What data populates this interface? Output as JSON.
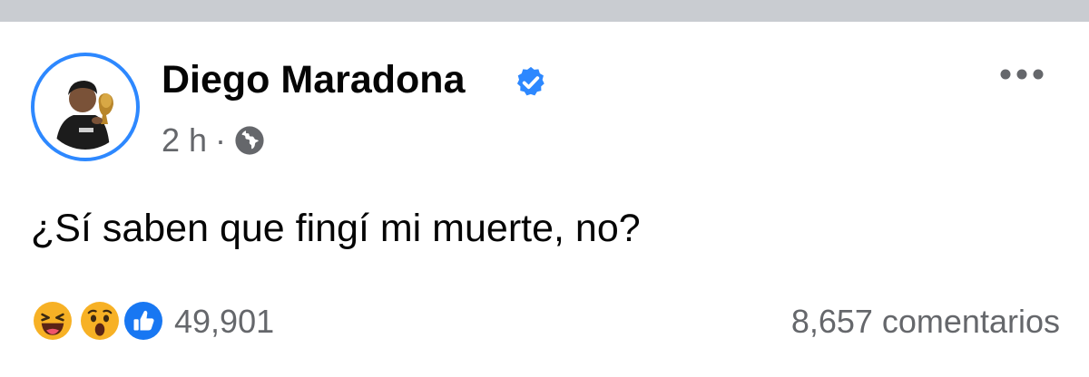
{
  "post": {
    "author": "Diego Maradona",
    "time": "2 h",
    "separator": "·",
    "text": "¿Sí saben que fingí mi muerte, no?",
    "reaction_count": "49,901",
    "comments": "8,657 comentarios",
    "reactions": [
      "laugh-reaction-icon",
      "wow-reaction-icon",
      "like-reaction-icon"
    ]
  },
  "colors": {
    "accent": "#2d88ff",
    "text": "#050505",
    "muted": "#65676b",
    "top_bar": "#c9ccd1"
  }
}
